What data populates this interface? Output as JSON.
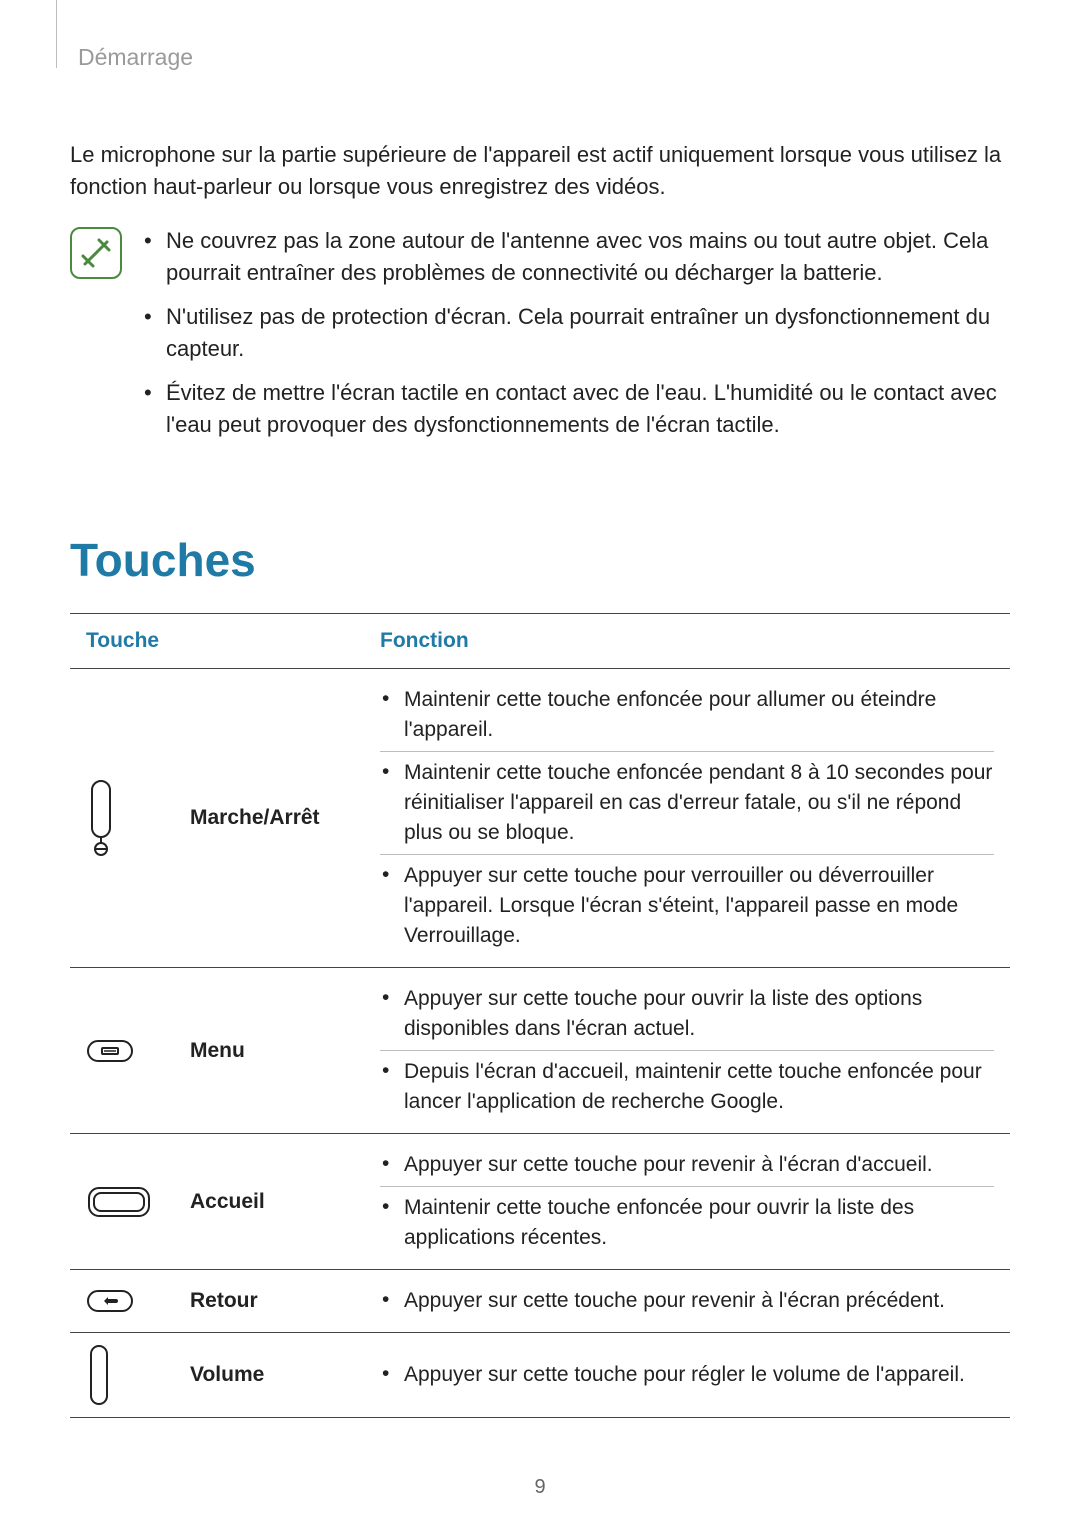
{
  "chapter": "Démarrage",
  "intro": "Le microphone sur la partie supérieure de l'appareil est actif uniquement lorsque vous utilisez la fonction haut-parleur ou lorsque vous enregistrez des vidéos.",
  "notes": [
    "Ne couvrez pas la zone autour de l'antenne avec vos mains ou tout autre objet. Cela pourrait entraîner des problèmes de connectivité ou décharger la batterie.",
    "N'utilisez pas de protection d'écran. Cela pourrait entraîner un dysfonctionnement du capteur.",
    "Évitez de mettre l'écran tactile en contact avec de l'eau. L'humidité ou le contact avec l'eau peut provoquer des dysfonctionnements de l'écran tactile."
  ],
  "section_title": "Touches",
  "table": {
    "header_touche": "Touche",
    "header_fonction": "Fonction",
    "rows": [
      {
        "label": "Marche/Arrêt",
        "functions": [
          "Maintenir cette touche enfoncée pour allumer ou éteindre l'appareil.",
          "Maintenir cette touche enfoncée pendant 8 à 10 secondes pour réinitialiser l'appareil en cas d'erreur fatale, ou s'il ne répond plus ou se bloque.",
          "Appuyer sur cette touche pour verrouiller ou déverrouiller l'appareil. Lorsque l'écran s'éteint, l'appareil passe en mode Verrouillage."
        ]
      },
      {
        "label": "Menu",
        "functions": [
          "Appuyer sur cette touche pour ouvrir la liste des options disponibles dans l'écran actuel.",
          "Depuis l'écran d'accueil, maintenir cette touche enfoncée pour lancer l'application de recherche Google."
        ]
      },
      {
        "label": "Accueil",
        "functions": [
          "Appuyer sur cette touche pour revenir à l'écran d'accueil.",
          "Maintenir cette touche enfoncée pour ouvrir la liste des applications récentes."
        ]
      },
      {
        "label": "Retour",
        "functions": [
          "Appuyer sur cette touche pour revenir à l'écran précédent."
        ]
      },
      {
        "label": "Volume",
        "functions": [
          "Appuyer sur cette touche pour régler le volume de l'appareil."
        ]
      }
    ]
  },
  "page_number": "9"
}
